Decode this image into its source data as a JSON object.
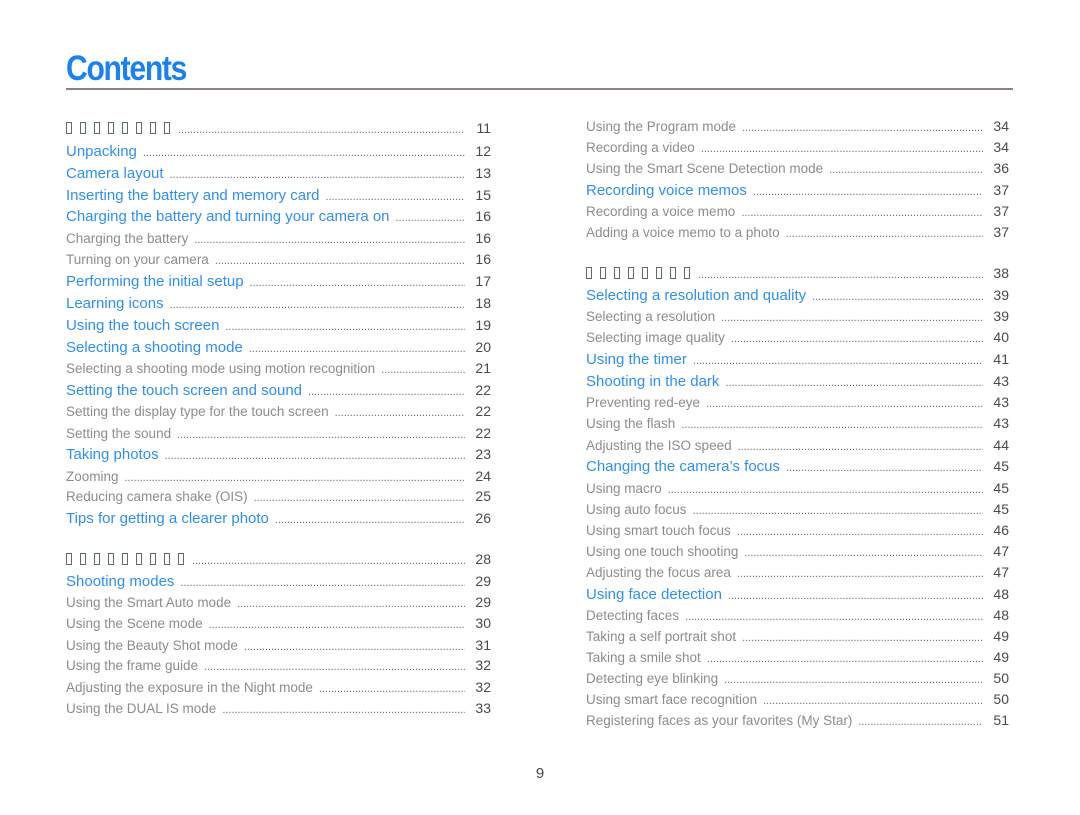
{
  "page": {
    "title": "Contents",
    "page_number": "9"
  },
  "left_column": [
    {
      "level": "heading",
      "label": "▯▯▯▯▯▯▯▯",
      "tofu_count": 8,
      "page": "11"
    },
    {
      "level": 1,
      "label": "Unpacking",
      "page": "12"
    },
    {
      "level": 1,
      "label": "Camera layout",
      "page": "13"
    },
    {
      "level": 1,
      "label": "Inserting the battery and memory card",
      "page": "15"
    },
    {
      "level": 1,
      "label": "Charging the battery and turning your camera on",
      "page": "16"
    },
    {
      "level": 2,
      "label": "Charging the battery",
      "page": "16"
    },
    {
      "level": 2,
      "label": "Turning on your camera",
      "page": "16"
    },
    {
      "level": 1,
      "label": "Performing the initial setup",
      "page": "17"
    },
    {
      "level": 1,
      "label": "Learning icons",
      "page": "18"
    },
    {
      "level": 1,
      "label": "Using the touch screen",
      "page": "19"
    },
    {
      "level": 1,
      "label": "Selecting a shooting mode",
      "page": "20"
    },
    {
      "level": 2,
      "label": "Selecting a shooting mode using motion recognition",
      "page": "21"
    },
    {
      "level": 1,
      "label": "Setting the touch screen and sound",
      "page": "22"
    },
    {
      "level": 2,
      "label": "Setting the display type for the touch screen",
      "page": "22"
    },
    {
      "level": 2,
      "label": "Setting the sound",
      "page": "22"
    },
    {
      "level": 1,
      "label": "Taking photos",
      "page": "23"
    },
    {
      "level": 2,
      "label": "Zooming",
      "page": "24"
    },
    {
      "level": 2,
      "label": "Reducing camera shake (OIS)",
      "page": "25"
    },
    {
      "level": 1,
      "label": "Tips for getting a clearer photo",
      "page": "26"
    },
    {
      "level": "heading",
      "label": "▯▯▯▯▯▯▯▯▯",
      "tofu_count": 9,
      "page": "28"
    },
    {
      "level": 1,
      "label": "Shooting modes",
      "page": "29"
    },
    {
      "level": 2,
      "label": "Using the Smart Auto mode",
      "page": "29"
    },
    {
      "level": 2,
      "label": "Using the Scene mode",
      "page": "30"
    },
    {
      "level": 2,
      "label": "Using the Beauty Shot mode",
      "page": "31"
    },
    {
      "level": 2,
      "label": "Using the frame guide",
      "page": "32"
    },
    {
      "level": 2,
      "label": "Adjusting the exposure in the Night mode",
      "page": "32"
    },
    {
      "level": 2,
      "label": "Using the DUAL IS mode",
      "page": "33"
    }
  ],
  "right_column": [
    {
      "level": 2,
      "label": "Using the Program mode",
      "page": "34"
    },
    {
      "level": 2,
      "label": "Recording a video",
      "page": "34"
    },
    {
      "level": 2,
      "label": "Using the Smart Scene Detection mode",
      "page": "36"
    },
    {
      "level": 1,
      "label": "Recording voice memos",
      "page": "37"
    },
    {
      "level": 2,
      "label": "Recording a voice memo",
      "page": "37"
    },
    {
      "level": 2,
      "label": "Adding a voice memo to a photo",
      "page": "37"
    },
    {
      "level": "heading",
      "label": "▯▯▯▯▯▯▯▯",
      "tofu_count": 8,
      "page": "38"
    },
    {
      "level": 1,
      "label": "Selecting a resolution and quality",
      "page": "39"
    },
    {
      "level": 2,
      "label": "Selecting a resolution",
      "page": "39"
    },
    {
      "level": 2,
      "label": "Selecting image quality",
      "page": "40"
    },
    {
      "level": 1,
      "label": "Using the timer",
      "page": "41"
    },
    {
      "level": 1,
      "label": "Shooting in the dark",
      "page": "43"
    },
    {
      "level": 2,
      "label": "Preventing red-eye",
      "page": "43"
    },
    {
      "level": 2,
      "label": "Using the flash",
      "page": "43"
    },
    {
      "level": 2,
      "label": "Adjusting the ISO speed",
      "page": "44"
    },
    {
      "level": 1,
      "label": "Changing the camera’s focus",
      "page": "45"
    },
    {
      "level": 2,
      "label": "Using macro",
      "page": "45"
    },
    {
      "level": 2,
      "label": "Using auto focus",
      "page": "45"
    },
    {
      "level": 2,
      "label": "Using smart touch focus",
      "page": "46"
    },
    {
      "level": 2,
      "label": "Using one touch shooting",
      "page": "47"
    },
    {
      "level": 2,
      "label": "Adjusting the focus area",
      "page": "47"
    },
    {
      "level": 1,
      "label": "Using face detection",
      "page": "48"
    },
    {
      "level": 2,
      "label": "Detecting faces",
      "page": "48"
    },
    {
      "level": 2,
      "label": "Taking a self portrait shot",
      "page": "49"
    },
    {
      "level": 2,
      "label": "Taking a smile shot",
      "page": "49"
    },
    {
      "level": 2,
      "label": "Detecting eye blinking",
      "page": "50"
    },
    {
      "level": 2,
      "label": "Using smart face recognition",
      "page": "50"
    },
    {
      "level": 2,
      "label": "Registering faces as your favorites (My Star)",
      "page": "51"
    }
  ],
  "colors": {
    "title": "#1a82f0",
    "level1": "#2e8ff2",
    "level2": "#8c8c8c",
    "page_numbers": "#4a4a4a",
    "rule": "#8c817d"
  }
}
